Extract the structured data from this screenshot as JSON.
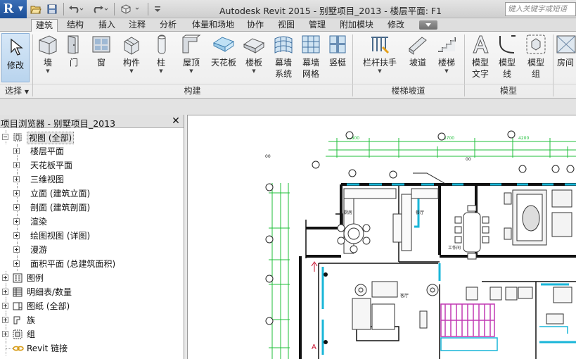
{
  "title_bar": {
    "app_logo": "R",
    "window_title": "Autodesk Revit 2015 -     别墅项目_2013 - 楼层平面: F1",
    "search_placeholder": "键入关键字或短语"
  },
  "tabs": [
    "建筑",
    "结构",
    "插入",
    "注释",
    "分析",
    "体量和场地",
    "协作",
    "视图",
    "管理",
    "附加模块",
    "修改"
  ],
  "active_tab": "建筑",
  "ribbon": {
    "modify_label": "修改",
    "select_label": "选择",
    "buttons": [
      {
        "lines": [
          "墙"
        ],
        "icon": "wall-icon"
      },
      {
        "lines": [
          "门"
        ],
        "icon": "door-icon"
      },
      {
        "lines": [
          "窗"
        ],
        "icon": "window-icon"
      },
      {
        "lines": [
          "构件"
        ],
        "icon": "component-icon"
      },
      {
        "lines": [
          "柱"
        ],
        "icon": "column-icon"
      },
      {
        "lines": [
          "屋顶"
        ],
        "icon": "roof-icon"
      },
      {
        "lines": [
          "天花板"
        ],
        "icon": "ceiling-icon"
      },
      {
        "lines": [
          "楼板"
        ],
        "icon": "floor-icon"
      },
      {
        "lines": [
          "幕墙",
          "系统"
        ],
        "icon": "curtain-system-icon"
      },
      {
        "lines": [
          "幕墙",
          "网格"
        ],
        "icon": "curtain-grid-icon"
      },
      {
        "lines": [
          "竖梃"
        ],
        "icon": "mullion-icon"
      },
      {
        "lines": [
          "栏杆扶手"
        ],
        "icon": "railing-icon"
      },
      {
        "lines": [
          "坡道"
        ],
        "icon": "ramp-icon"
      },
      {
        "lines": [
          "楼梯"
        ],
        "icon": "stair-icon"
      },
      {
        "lines": [
          "模型",
          "文字"
        ],
        "icon": "model-text-icon"
      },
      {
        "lines": [
          "模型",
          "线"
        ],
        "icon": "model-line-icon"
      },
      {
        "lines": [
          "模型",
          "组"
        ],
        "icon": "model-group-icon"
      },
      {
        "lines": [
          "房间"
        ],
        "icon": "room-icon"
      }
    ],
    "groups": [
      "选择",
      "构建",
      "楼梯坡道",
      "模型"
    ]
  },
  "project_browser": {
    "title": "项目浏览器 - 别墅项目_2013",
    "close_glyph": "✕",
    "tree": [
      {
        "label": "视图 (全部)",
        "level": 0,
        "expander": "minus",
        "icon": "views-icon",
        "selected": true
      },
      {
        "label": "楼层平面",
        "level": 1,
        "expander": "plus"
      },
      {
        "label": "天花板平面",
        "level": 1,
        "expander": "plus"
      },
      {
        "label": "三维视图",
        "level": 1,
        "expander": "plus"
      },
      {
        "label": "立面 (建筑立面)",
        "level": 1,
        "expander": "plus"
      },
      {
        "label": "剖面 (建筑剖面)",
        "level": 1,
        "expander": "plus"
      },
      {
        "label": "渲染",
        "level": 1,
        "expander": "plus"
      },
      {
        "label": "绘图视图 (详图)",
        "level": 1,
        "expander": "plus"
      },
      {
        "label": "漫游",
        "level": 1,
        "expander": "plus"
      },
      {
        "label": "面积平面 (总建筑面积)",
        "level": 1,
        "expander": "plus"
      },
      {
        "label": "图例",
        "level": 0,
        "expander": "plus",
        "icon": "legend-icon"
      },
      {
        "label": "明细表/数量",
        "level": 0,
        "expander": "plus",
        "icon": "schedule-icon"
      },
      {
        "label": "图纸 (全部)",
        "level": 0,
        "expander": "plus",
        "icon": "sheet-icon"
      },
      {
        "label": "族",
        "level": 0,
        "expander": "plus",
        "icon": "family-icon"
      },
      {
        "label": "组",
        "level": 0,
        "expander": "plus",
        "icon": "group-icon"
      },
      {
        "label": "Revit 链接",
        "level": 0,
        "expander": "none",
        "icon": "link-icon"
      }
    ]
  },
  "canvas": {
    "view": "楼层平面: F1",
    "room_labels": [
      "厨房",
      "餐厅",
      "客厅",
      "工作间"
    ],
    "section_mark": "A"
  },
  "colors": {
    "accent": "#3b6fb6",
    "grid_green": "#1fbf3a",
    "glazing_cyan": "#19b6d8",
    "highlight_magenta": "#c23ab4"
  }
}
